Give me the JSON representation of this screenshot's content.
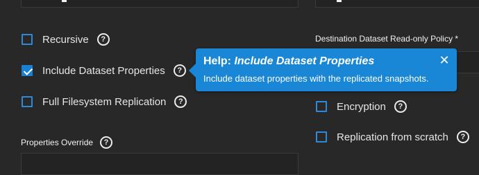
{
  "left": {
    "recursive_label": "Recursive",
    "include_props_label": "Include Dataset Properties",
    "full_fs_label": "Full Filesystem Replication",
    "properties_override_label": "Properties Override"
  },
  "right": {
    "readonly_policy_label": "Destination Dataset Read-only Policy *",
    "encryption_label": "Encryption",
    "from_scratch_label": "Replication from scratch"
  },
  "checkboxes": {
    "recursive": false,
    "include_props": true,
    "full_fs": false,
    "encryption": false,
    "from_scratch": false
  },
  "tooltip": {
    "prefix": "Help: ",
    "title": "Include Dataset Properties",
    "body": "Include dataset properties with the replicated  snapshots.",
    "close_glyph": "✕"
  },
  "help_glyph": "?",
  "colors": {
    "accent": "#1987d5",
    "background": "#282828"
  }
}
